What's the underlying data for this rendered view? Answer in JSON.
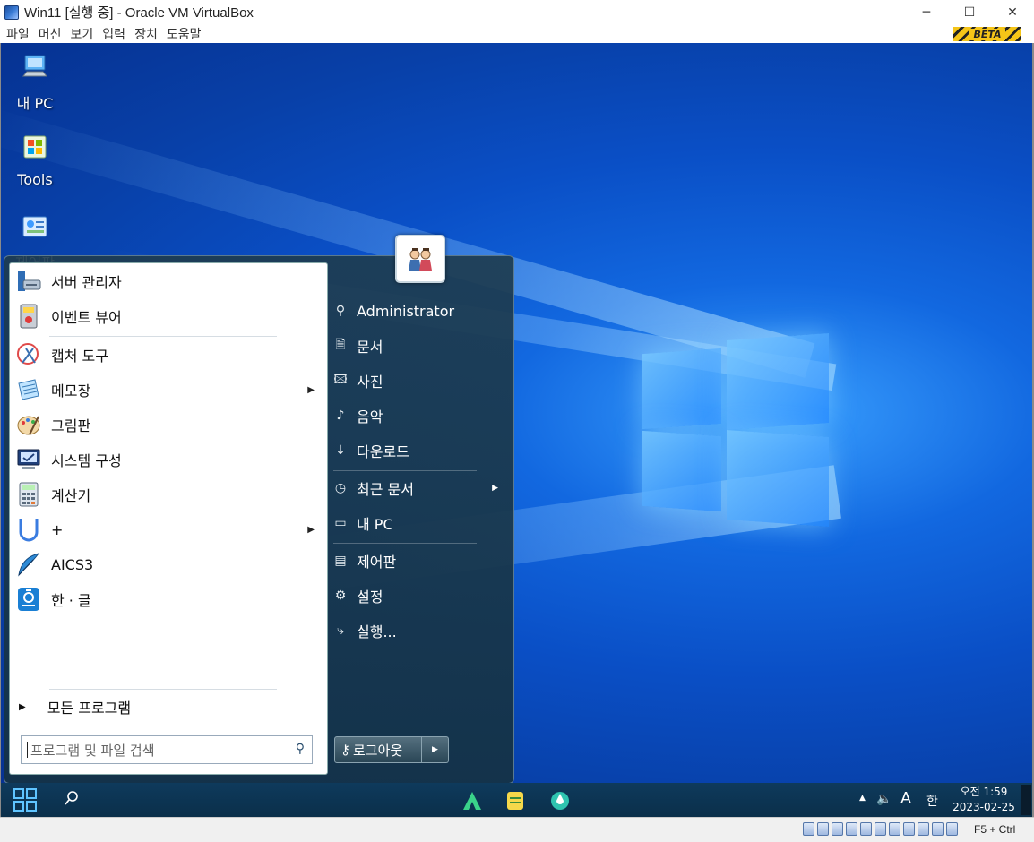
{
  "window": {
    "title": "Win11 [실행 중] - Oracle VM VirtualBox",
    "minimize_glyph": "─",
    "maximize_glyph": "☐",
    "close_glyph": "✕"
  },
  "menubar": {
    "items": [
      "파일",
      "머신",
      "보기",
      "입력",
      "장치",
      "도움말"
    ],
    "beta_label": "BETA"
  },
  "desktop": {
    "icons": [
      {
        "label": "내 PC",
        "icon": "computer-icon"
      },
      {
        "label": "Tools",
        "icon": "windows-flag-icon"
      },
      {
        "label": "제어판",
        "icon": "control-panel-icon"
      }
    ]
  },
  "start_menu": {
    "pinned": [
      {
        "label": "서버 관리자",
        "icon": "server-manager-icon",
        "has_submenu": false
      },
      {
        "label": "이벤트 뷰어",
        "icon": "event-viewer-icon",
        "has_submenu": false
      }
    ],
    "recent": [
      {
        "label": "캡처 도구",
        "icon": "snipping-tool-icon",
        "has_submenu": false
      },
      {
        "label": "메모장",
        "icon": "notepad-icon",
        "has_submenu": true
      },
      {
        "label": "그림판",
        "icon": "paint-icon",
        "has_submenu": false
      },
      {
        "label": "시스템 구성",
        "icon": "system-config-icon",
        "has_submenu": false
      },
      {
        "label": "계산기",
        "icon": "calculator-icon",
        "has_submenu": false
      },
      {
        "label": "+",
        "icon": "magnet-icon",
        "has_submenu": true
      },
      {
        "label": "AICS3",
        "icon": "feather-icon",
        "has_submenu": false
      },
      {
        "label": "한 · 글",
        "icon": "hangul-icon",
        "has_submenu": false
      }
    ],
    "all_programs": "모든 프로그램",
    "search_placeholder": "프로그램 및 파일 검색",
    "right_items": [
      {
        "label": "Administrator",
        "icon": "user-folder-icon",
        "glyph": "⚲"
      },
      {
        "label": "문서",
        "icon": "document-icon",
        "glyph": "🗎"
      },
      {
        "label": "사진",
        "icon": "picture-icon",
        "glyph": "🖾"
      },
      {
        "label": "음악",
        "icon": "music-icon",
        "glyph": "♪"
      },
      {
        "label": "다운로드",
        "icon": "download-icon",
        "glyph": "↓"
      },
      {
        "label": "최근 문서",
        "icon": "recent-icon",
        "glyph": "◷",
        "has_submenu": true
      },
      {
        "label": "내 PC",
        "icon": "computer-icon",
        "glyph": "▭"
      },
      {
        "label": "제어판",
        "icon": "control-panel-icon",
        "glyph": "▤"
      },
      {
        "label": "설정",
        "icon": "settings-gear-icon",
        "glyph": "⚙"
      },
      {
        "label": "실행...",
        "icon": "run-icon",
        "glyph": "⤷"
      }
    ],
    "logout_label": "로그아웃"
  },
  "taskbar": {
    "clock_period": "오전 1:59",
    "date": "2023-02-25",
    "ime_lang": "A",
    "ime_mode": "한",
    "tray_overflow": "▲",
    "volume_glyph": "🔈"
  },
  "status_bar": {
    "host_key": "F5 + Ctrl"
  },
  "colors": {
    "desktop_blue": "#0a4fc6",
    "start_panel": "#1e3c50",
    "taskbar": "#0e3a5c"
  }
}
